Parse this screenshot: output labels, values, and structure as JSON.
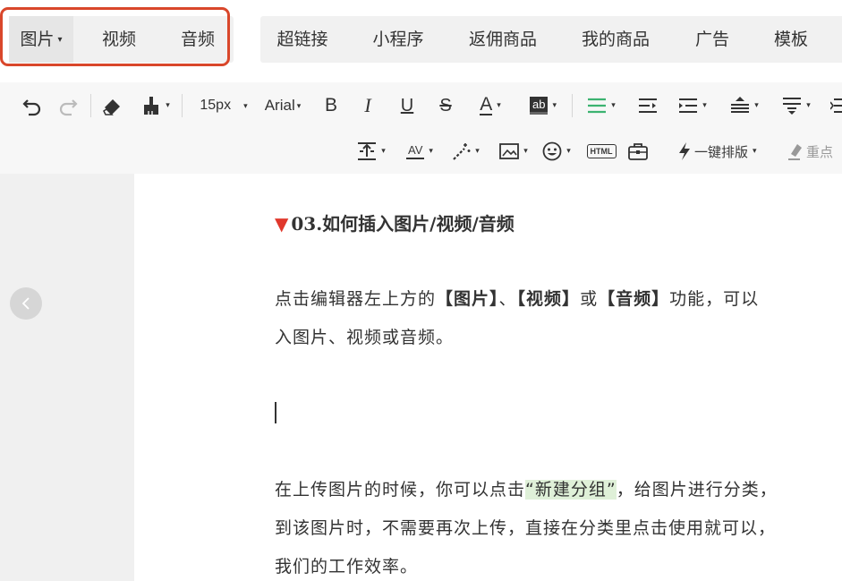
{
  "media_tabs": [
    {
      "label": "图片",
      "has_caret": true
    },
    {
      "label": "视频"
    },
    {
      "label": "音频"
    }
  ],
  "insert_tabs": [
    {
      "label": "超链接"
    },
    {
      "label": "小程序"
    },
    {
      "label": "返佣商品"
    },
    {
      "label": "我的商品"
    },
    {
      "label": "广告"
    },
    {
      "label": "模板"
    }
  ],
  "toolbar": {
    "font_size": "15px",
    "font_family": "Arial",
    "bold": "B",
    "italic": "I",
    "underline": "U",
    "strike": "S",
    "font_color": "A",
    "bg_color": "ab",
    "letter_spacing": "AV",
    "html": "HTML",
    "one_click_layout": "一键排版",
    "highlight_partial": "重点"
  },
  "article": {
    "heading_marker": "▼",
    "heading": "03.如何插入图片/视频/音频",
    "p1": {
      "a": "点击编辑器左上方的",
      "b1": "【图片】",
      "sep1": "、",
      "b2": "【视频】",
      "sep2": "或",
      "b3": "【音频】",
      "c": "功能，可以",
      "line2": "入图片、视频或音频。"
    },
    "p2": {
      "a": "在上传图片的时候，你可以点击",
      "hl": "“新建分组”",
      "b": "，给图片进行分类，",
      "line2": "到该图片时，不需要再次上传，直接在分类里点击使用就可以，",
      "line3": "我们的工作效率。"
    }
  },
  "colors": {
    "highlight_border": "#d9472b",
    "heading_marker": "#e0382c",
    "text_highlight": "#dff0d8",
    "align_icon": "#3cb371"
  }
}
